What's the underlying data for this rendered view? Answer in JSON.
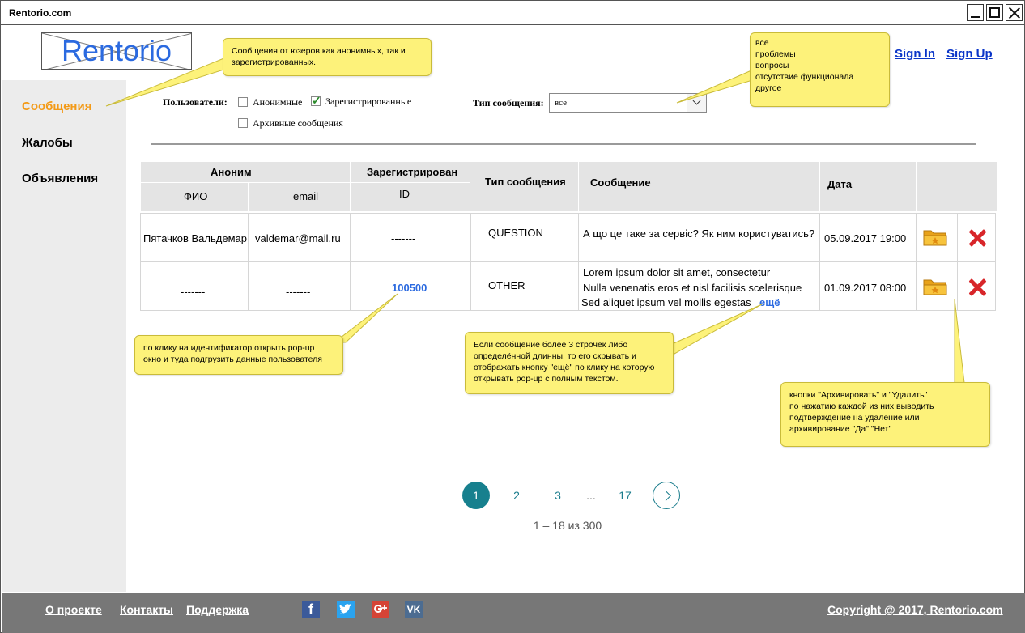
{
  "window": {
    "title": "Rentorio.com"
  },
  "brand": {
    "logo_text": "Rentorio",
    "logo_note": "logo"
  },
  "auth": {
    "sign_in": "Sign In",
    "sign_up": "Sign Up"
  },
  "sidebar": {
    "items": [
      {
        "label": "Сообщения",
        "active": true
      },
      {
        "label": "Жалобы",
        "active": false
      },
      {
        "label": "Объявления",
        "active": false
      }
    ]
  },
  "filters": {
    "users_label": "Пользователи:",
    "anonymous": {
      "label": "Анонимные",
      "checked": false
    },
    "registered": {
      "label": "Зарегистрированные",
      "checked": true
    },
    "archived": {
      "label": "Архивные сообщения",
      "checked": false
    },
    "type_label": "Тип сообщения:",
    "type_value": "все"
  },
  "table": {
    "headers": {
      "anonym": "Аноним",
      "fio": "ФИО",
      "email": "email",
      "registered": "Зарегистрирован",
      "id": "ID",
      "type": "Тип сообщения",
      "message": "Сообщение",
      "date": "Дата"
    },
    "rows": [
      {
        "fio": "Пятачков Вальдемар",
        "email": "valdemar@mail.ru",
        "id": "-------",
        "type": "QUESTION",
        "message_lines": [
          "А що це таке за сервіс? Як ним користуватись?"
        ],
        "more": "",
        "date": "05.09.2017 19:00"
      },
      {
        "fio": "-------",
        "email": "-------",
        "id": "100500",
        "type": "OTHER",
        "message_lines": [
          "Lorem ipsum dolor sit amet, consectetur",
          "Nulla venenatis eros et nisl facilisis scelerisque",
          "Sed aliquet ipsum vel mollis egestas"
        ],
        "more": "ещё",
        "date": "01.09.2017 08:00"
      }
    ]
  },
  "notes": {
    "messages": [
      "Сообщения от юзеров как анонимных, так и",
      "зарегистрированных."
    ],
    "types": [
      "все",
      "проблемы",
      "вопросы",
      "отсутствие функционала",
      "другое"
    ],
    "id_popup": [
      "по клику на идентификатор открыть pop-up",
      "окно и туда подгрузить данные пользователя"
    ],
    "long_message": [
      "Если сообщение более 3 строчек либо",
      "определённой длинны, то его скрывать и",
      "отображать кнопку \"ещё\" по клику на которую",
      "открывать pop-up с полным текстом."
    ],
    "actions": [
      "кнопки \"Архивировать\" и \"Удалить\"",
      "по нажатию каждой из них выводить",
      "подтверждение на удаление или",
      "архивирование \"Да\" \"Нет\""
    ]
  },
  "pagination": {
    "pages": [
      "1",
      "2",
      "3",
      "...",
      "17"
    ],
    "current": "1",
    "info": "1 – 18 из 300"
  },
  "footer": {
    "links": [
      "О проекте",
      "Контакты",
      "Поддержка"
    ],
    "social": [
      "f",
      "VK"
    ],
    "copyright": "Copyright @ 2017, Rentorio.com"
  },
  "colors": {
    "accent": "#f39a17",
    "link": "#2b6ae0",
    "pagination": "#17808e",
    "note": "#fdf27a",
    "footer": "#777777",
    "delete": "#d8262a"
  }
}
